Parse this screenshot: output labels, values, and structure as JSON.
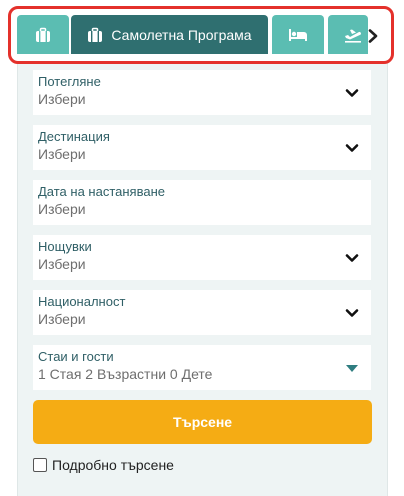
{
  "tabs": [
    {
      "icon": "suitcase-icon",
      "label": ""
    },
    {
      "icon": "suitcase-icon",
      "label": "Самолетна Програма",
      "active": true
    },
    {
      "icon": "bed-icon",
      "label": ""
    },
    {
      "icon": "plane-departure-icon",
      "label": ""
    }
  ],
  "tabs_scroll_icon": "chevron-right-icon",
  "fields": {
    "departure": {
      "label": "Потегляне",
      "value": "Избери"
    },
    "destination": {
      "label": "Дестинация",
      "value": "Избери"
    },
    "checkin": {
      "label": "Дата на настаняване",
      "value": "Избери"
    },
    "nights": {
      "label": "Нощувки",
      "value": "Избери"
    },
    "nationality": {
      "label": "Националност",
      "value": "Избери"
    },
    "rooms": {
      "label": "Стаи и гости",
      "value": "1 Стая 2 Възрастни 0 Дете"
    }
  },
  "search_button": "Търсене",
  "advanced_search": "Подробно търсене",
  "colors": {
    "tab": "#5bbdb2",
    "tab_active": "#2f6f70",
    "button": "#f5ac14",
    "highlight": "#e4312b",
    "panel": "#eef4f4"
  }
}
